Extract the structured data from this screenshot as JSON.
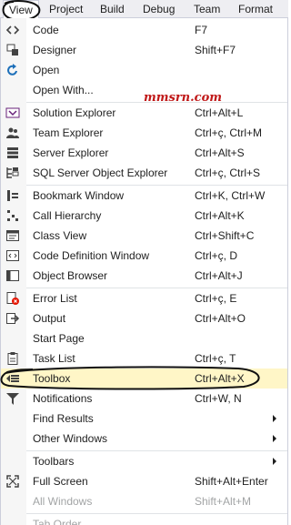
{
  "menubar": {
    "items": [
      {
        "label": "View"
      },
      {
        "label": "Project"
      },
      {
        "label": "Build"
      },
      {
        "label": "Debug"
      },
      {
        "label": "Team"
      },
      {
        "label": "Format"
      }
    ]
  },
  "watermark": "mmsrn.com",
  "menu": {
    "code": {
      "label": "Code",
      "shortcut": "F7",
      "icon": "code-icon"
    },
    "designer": {
      "label": "Designer",
      "shortcut": "Shift+F7",
      "icon": "designer-icon"
    },
    "open": {
      "label": "Open",
      "icon": "open-icon"
    },
    "open_with": {
      "label": "Open With..."
    },
    "solution_explorer": {
      "label": "Solution Explorer",
      "shortcut": "Ctrl+Alt+L",
      "icon": "solution-explorer-icon"
    },
    "team_explorer": {
      "label": "Team Explorer",
      "shortcut": "Ctrl+ç, Ctrl+M",
      "icon": "team-explorer-icon"
    },
    "server_explorer": {
      "label": "Server Explorer",
      "shortcut": "Ctrl+Alt+S",
      "icon": "server-explorer-icon"
    },
    "sql_explorer": {
      "label": "SQL Server Object Explorer",
      "shortcut": "Ctrl+ç, Ctrl+S",
      "icon": "sql-explorer-icon"
    },
    "bookmark": {
      "label": "Bookmark Window",
      "shortcut": "Ctrl+K, Ctrl+W",
      "icon": "bookmark-icon"
    },
    "call_hierarchy": {
      "label": "Call Hierarchy",
      "shortcut": "Ctrl+Alt+K",
      "icon": "call-hierarchy-icon"
    },
    "class_view": {
      "label": "Class View",
      "shortcut": "Ctrl+Shift+C",
      "icon": "class-view-icon"
    },
    "code_definition": {
      "label": "Code Definition Window",
      "shortcut": "Ctrl+ç, D",
      "icon": "code-definition-icon"
    },
    "object_browser": {
      "label": "Object Browser",
      "shortcut": "Ctrl+Alt+J",
      "icon": "object-browser-icon"
    },
    "error_list": {
      "label": "Error List",
      "shortcut": "Ctrl+ç, E",
      "icon": "error-list-icon"
    },
    "output": {
      "label": "Output",
      "shortcut": "Ctrl+Alt+O",
      "icon": "output-icon"
    },
    "start_page": {
      "label": "Start Page",
      "icon": "start-page-icon"
    },
    "task_list": {
      "label": "Task List",
      "shortcut": "Ctrl+ç, T",
      "icon": "task-list-icon"
    },
    "toolbox": {
      "label": "Toolbox",
      "shortcut": "Ctrl+Alt+X",
      "icon": "toolbox-icon"
    },
    "notifications": {
      "label": "Notifications",
      "shortcut": "Ctrl+W, N",
      "icon": "notifications-icon"
    },
    "find_results": {
      "label": "Find Results"
    },
    "other_windows": {
      "label": "Other Windows"
    },
    "toolbars": {
      "label": "Toolbars"
    },
    "full_screen": {
      "label": "Full Screen",
      "shortcut": "Shift+Alt+Enter",
      "icon": "full-screen-icon"
    },
    "all_windows": {
      "label": "All Windows",
      "shortcut": "Shift+Alt+M"
    },
    "tab_order": {
      "label": "Tab Order"
    }
  },
  "colors": {
    "highlight": "#fff6c7",
    "watermark": "#c01818",
    "accent_blue": "#1c6fb9",
    "disabled_text": "#a2a4a5"
  }
}
